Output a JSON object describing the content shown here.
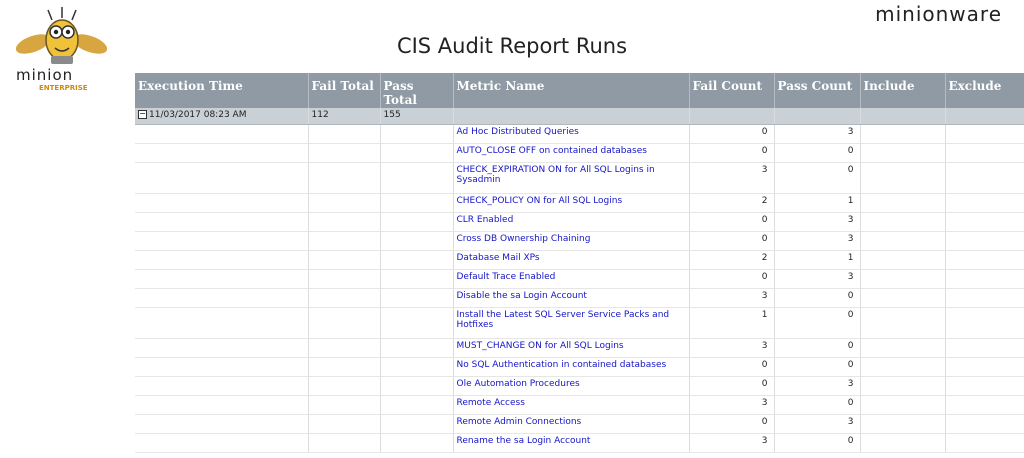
{
  "brand": {
    "left_logo_text_top": "minion",
    "left_logo_text_bottom": "ENTERPRISE",
    "right_logo_text": "minionware"
  },
  "report": {
    "title": "CIS Audit Report Runs"
  },
  "table": {
    "headers": [
      "Execution Time",
      "Fail Total",
      "Pass Total",
      "Metric Name",
      "Fail Count",
      "Pass Count",
      "Include",
      "Exclude"
    ],
    "group": {
      "execution_time": "11/03/2017 08:23 AM",
      "fail_total": "112",
      "pass_total": "155",
      "expander": "−"
    },
    "rows": [
      {
        "metric": "Ad Hoc Distributed Queries",
        "fail": "0",
        "pass": "3"
      },
      {
        "metric": "AUTO_CLOSE OFF on contained databases",
        "fail": "0",
        "pass": "0"
      },
      {
        "metric": "CHECK_EXPIRATION ON for All SQL Logins in Sysadmin",
        "fail": "3",
        "pass": "0"
      },
      {
        "metric": "CHECK_POLICY ON for All SQL Logins",
        "fail": "2",
        "pass": "1"
      },
      {
        "metric": "CLR Enabled",
        "fail": "0",
        "pass": "3"
      },
      {
        "metric": "Cross DB Ownership Chaining",
        "fail": "0",
        "pass": "3"
      },
      {
        "metric": "Database Mail XPs",
        "fail": "2",
        "pass": "1"
      },
      {
        "metric": "Default Trace Enabled",
        "fail": "0",
        "pass": "3"
      },
      {
        "metric": "Disable the sa Login Account",
        "fail": "3",
        "pass": "0"
      },
      {
        "metric": "Install the Latest SQL Server Service Packs and Hotfixes",
        "fail": "1",
        "pass": "0"
      },
      {
        "metric": "MUST_CHANGE ON for All SQL Logins",
        "fail": "3",
        "pass": "0"
      },
      {
        "metric": "No SQL Authentication in contained databases",
        "fail": "0",
        "pass": "0"
      },
      {
        "metric": "Ole Automation Procedures",
        "fail": "0",
        "pass": "3"
      },
      {
        "metric": "Remote Access",
        "fail": "3",
        "pass": "0"
      },
      {
        "metric": "Remote Admin Connections",
        "fail": "0",
        "pass": "3"
      },
      {
        "metric": "Rename the sa Login Account",
        "fail": "3",
        "pass": "0"
      }
    ]
  }
}
